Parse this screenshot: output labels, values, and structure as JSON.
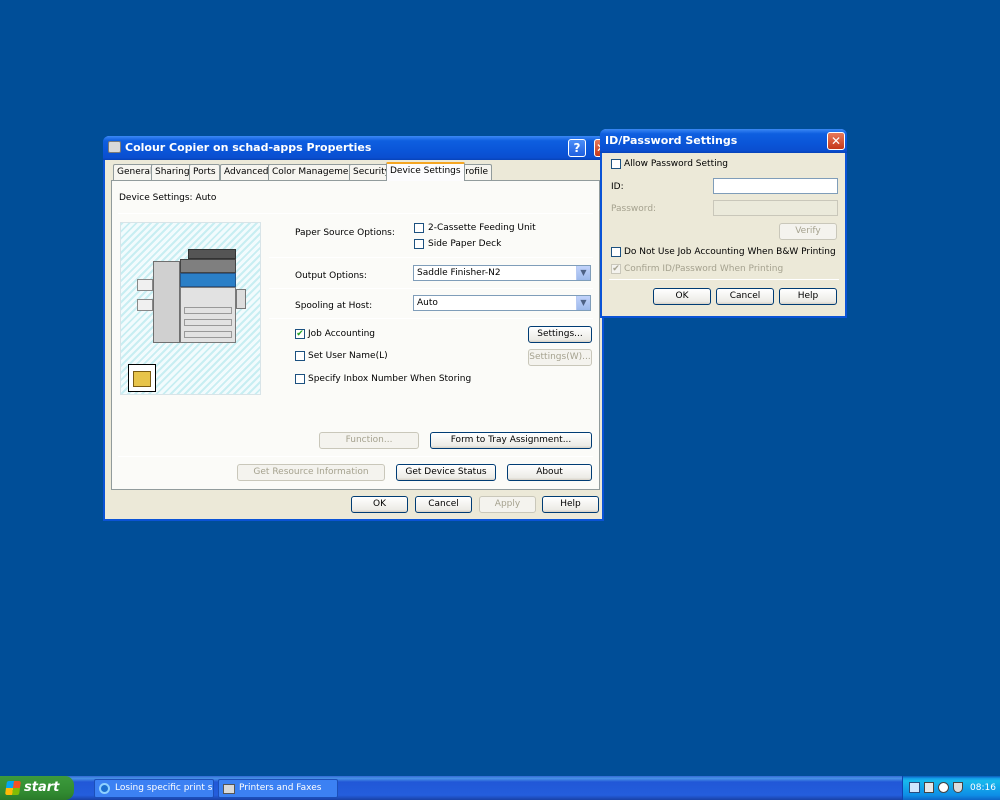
{
  "colors": {
    "desktop": "#004e98",
    "title_blue": "#0a55d8",
    "dialog_bg": "#ece9d8",
    "tab_highlight": "#f5a623"
  },
  "props": {
    "title": "Colour Copier on schad-apps Properties",
    "title_icon": "printer-icon",
    "tabs": [
      "General",
      "Sharing",
      "Ports",
      "Advanced",
      "Color Management",
      "Security",
      "Device Settings",
      "Profile"
    ],
    "active_tab": "Device Settings",
    "device_settings_label": "Device Settings: Auto",
    "paper_source_label": "Paper Source Options:",
    "cassette_label": "2-Cassette Feeding Unit",
    "cassette_checked": false,
    "side_deck_label": "Side Paper Deck",
    "side_deck_checked": false,
    "output_label": "Output Options:",
    "output_value": "Saddle Finisher-N2",
    "spooling_label": "Spooling at Host:",
    "spooling_value": "Auto",
    "job_accounting_label": "Job Accounting",
    "job_accounting_checked": true,
    "settings_button": "Settings...",
    "set_user_label": "Set User Name(L)",
    "set_user_checked": false,
    "settings_w_button": "Settings(W)...",
    "inbox_label": "Specify Inbox Number When Storing",
    "inbox_checked": false,
    "function_button": "Function...",
    "form_tray_button": "Form to Tray Assignment...",
    "get_resource_button": "Get Resource Information",
    "get_device_status_button": "Get Device Status",
    "about_button": "About",
    "ok": "OK",
    "cancel": "Cancel",
    "apply": "Apply",
    "help": "Help"
  },
  "idpw": {
    "title": "ID/Password Settings",
    "allow_label": "Allow Password Setting",
    "allow_checked": false,
    "id_label": "ID:",
    "id_value": "",
    "password_label": "Password:",
    "password_value": "",
    "verify_button": "Verify",
    "no_bw_label": "Do Not Use Job Accounting When B&W Printing",
    "no_bw_checked": false,
    "confirm_label": "Confirm ID/Password When Printing",
    "confirm_checked": true,
    "ok": "OK",
    "cancel": "Cancel",
    "help": "Help"
  },
  "taskbar": {
    "start_label": "start",
    "tasks": [
      {
        "label": "Losing specific print s...",
        "icon": "ie-icon"
      },
      {
        "label": "Printers and Faxes",
        "icon": "printer-folder-icon"
      }
    ],
    "clock": "08:16"
  }
}
